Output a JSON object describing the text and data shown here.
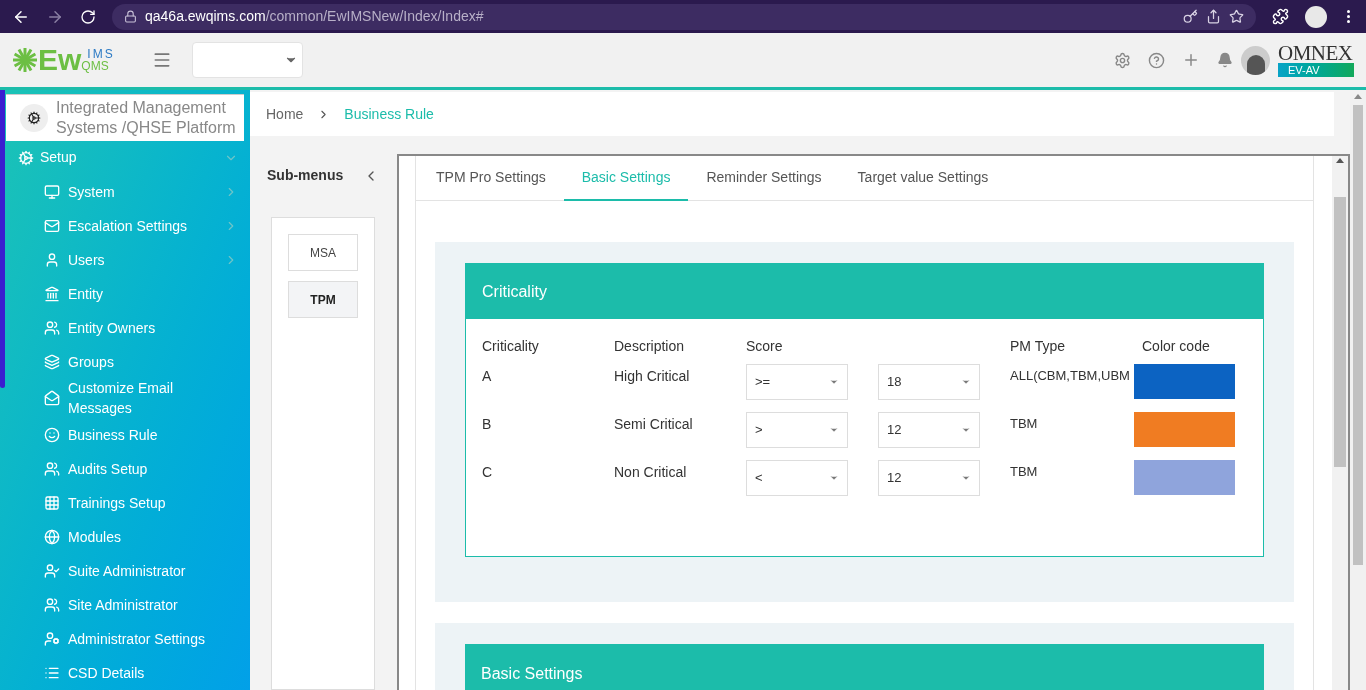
{
  "browser": {
    "url_domain": "qa46a.ewqims.com",
    "url_path": "/common/EwIMSNew/Index/Index#"
  },
  "header": {
    "logo_main": "Ew",
    "logo_top": "IMS",
    "logo_bottom": "QMS",
    "brand": "OMNEX",
    "brand_sub": "EV-AV"
  },
  "sidebar": {
    "platform": "Integrated Management Systems /QHSE Platform",
    "section": {
      "label": "Setup",
      "expanded": true
    },
    "items": [
      {
        "label": "System",
        "has_children": true
      },
      {
        "label": "Escalation Settings",
        "has_children": true
      },
      {
        "label": "Users",
        "has_children": true
      },
      {
        "label": "Entity",
        "has_children": false
      },
      {
        "label": "Entity Owners",
        "has_children": false
      },
      {
        "label": "Groups",
        "has_children": false
      },
      {
        "label": "Customize Email Messages",
        "has_children": false
      },
      {
        "label": "Business Rule",
        "has_children": false
      },
      {
        "label": "Audits Setup",
        "has_children": false
      },
      {
        "label": "Trainings Setup",
        "has_children": false
      },
      {
        "label": "Modules",
        "has_children": false
      },
      {
        "label": "Suite Administrator",
        "has_children": false
      },
      {
        "label": "Site Administrator",
        "has_children": false
      },
      {
        "label": "Administrator Settings",
        "has_children": false
      },
      {
        "label": "CSD Details",
        "has_children": false
      }
    ]
  },
  "breadcrumb": [
    {
      "label": "Home",
      "selected": false
    },
    {
      "label": "Business Rule",
      "selected": true
    }
  ],
  "submenus": {
    "title": "Sub-menus",
    "items": [
      {
        "label": "MSA",
        "selected": false
      },
      {
        "label": "TPM",
        "selected": true
      }
    ]
  },
  "tabs": [
    {
      "label": "TPM Pro Settings",
      "selected": false
    },
    {
      "label": "Basic Settings",
      "selected": true
    },
    {
      "label": "Reminder Settings",
      "selected": false
    },
    {
      "label": "Target value Settings",
      "selected": false
    }
  ],
  "criticality": {
    "title": "Criticality",
    "columns": [
      "Criticality",
      "Description",
      "Score",
      "PM Type",
      "Color code"
    ],
    "rows": [
      {
        "criticality": "A",
        "description": "High Critical",
        "operator": ">=",
        "score": "18",
        "pm_type": "ALL(CBM,TBM,UBM",
        "color": "#0c63c2"
      },
      {
        "criticality": "B",
        "description": "Semi Critical",
        "operator": ">",
        "score": "12",
        "pm_type": "TBM",
        "color": "#f07c22"
      },
      {
        "criticality": "C",
        "description": "Non Critical",
        "operator": "<",
        "score": "12",
        "pm_type": "TBM",
        "color": "#8fa4dc"
      }
    ]
  },
  "basic_settings": {
    "title": "Basic Settings"
  }
}
